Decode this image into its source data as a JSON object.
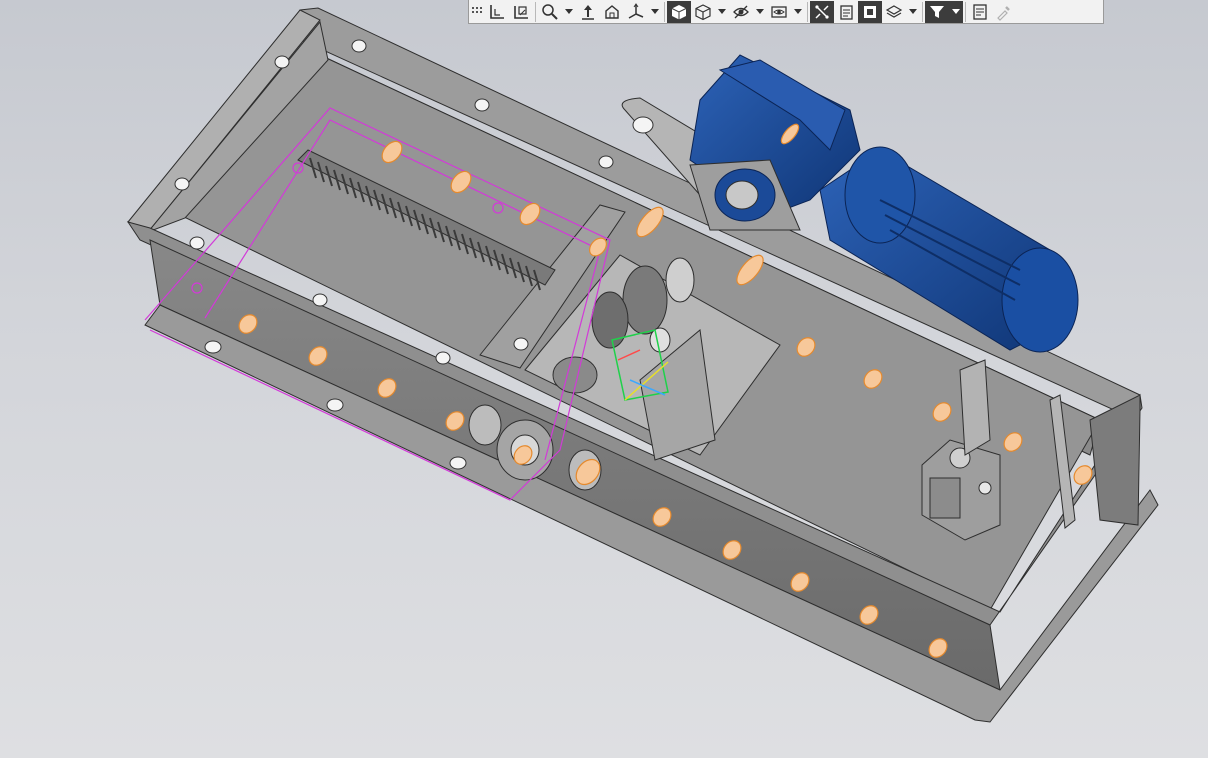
{
  "window": {
    "title": ""
  },
  "viewport": {
    "background_top": "#c6c9d0",
    "background_bottom": "#dedfe2",
    "model_colors": {
      "frame": "#8e8e8e",
      "frame_light": "#a7a7a7",
      "frame_dark": "#6f6f6f",
      "motor": "#1c4fa0",
      "motor_dark": "#123a7a",
      "fasteners": "#f0a050",
      "sketch": "#d23ad8"
    }
  },
  "toolbar": {
    "groups": [
      {
        "items": [
          {
            "icon": "grip-icon"
          },
          {
            "icon": "orientation-icon"
          },
          {
            "icon": "normal-to-icon"
          }
        ]
      },
      {
        "items": [
          {
            "icon": "zoom-icon",
            "dropdown": true
          },
          {
            "icon": "pan-icon"
          },
          {
            "icon": "rotate-icon"
          },
          {
            "icon": "axes-triad-icon",
            "dropdown": true
          }
        ]
      },
      {
        "items": [
          {
            "icon": "shaded-display-icon",
            "active": true
          },
          {
            "icon": "wireframe-display-icon",
            "dropdown": true
          },
          {
            "icon": "hide-show-icon",
            "dropdown": true
          },
          {
            "icon": "view-settings-icon",
            "dropdown": true
          }
        ]
      },
      {
        "items": [
          {
            "icon": "section-view-icon",
            "active": true
          },
          {
            "icon": "sheet-icon"
          },
          {
            "icon": "component-display-icon",
            "active": true
          },
          {
            "icon": "layers-icon",
            "dropdown": true
          }
        ]
      },
      {
        "items": [
          {
            "icon": "filter-icon",
            "active": true,
            "dropdown": true
          }
        ]
      },
      {
        "items": [
          {
            "icon": "properties-icon"
          },
          {
            "icon": "dropper-icon",
            "disabled": true
          }
        ]
      }
    ]
  }
}
